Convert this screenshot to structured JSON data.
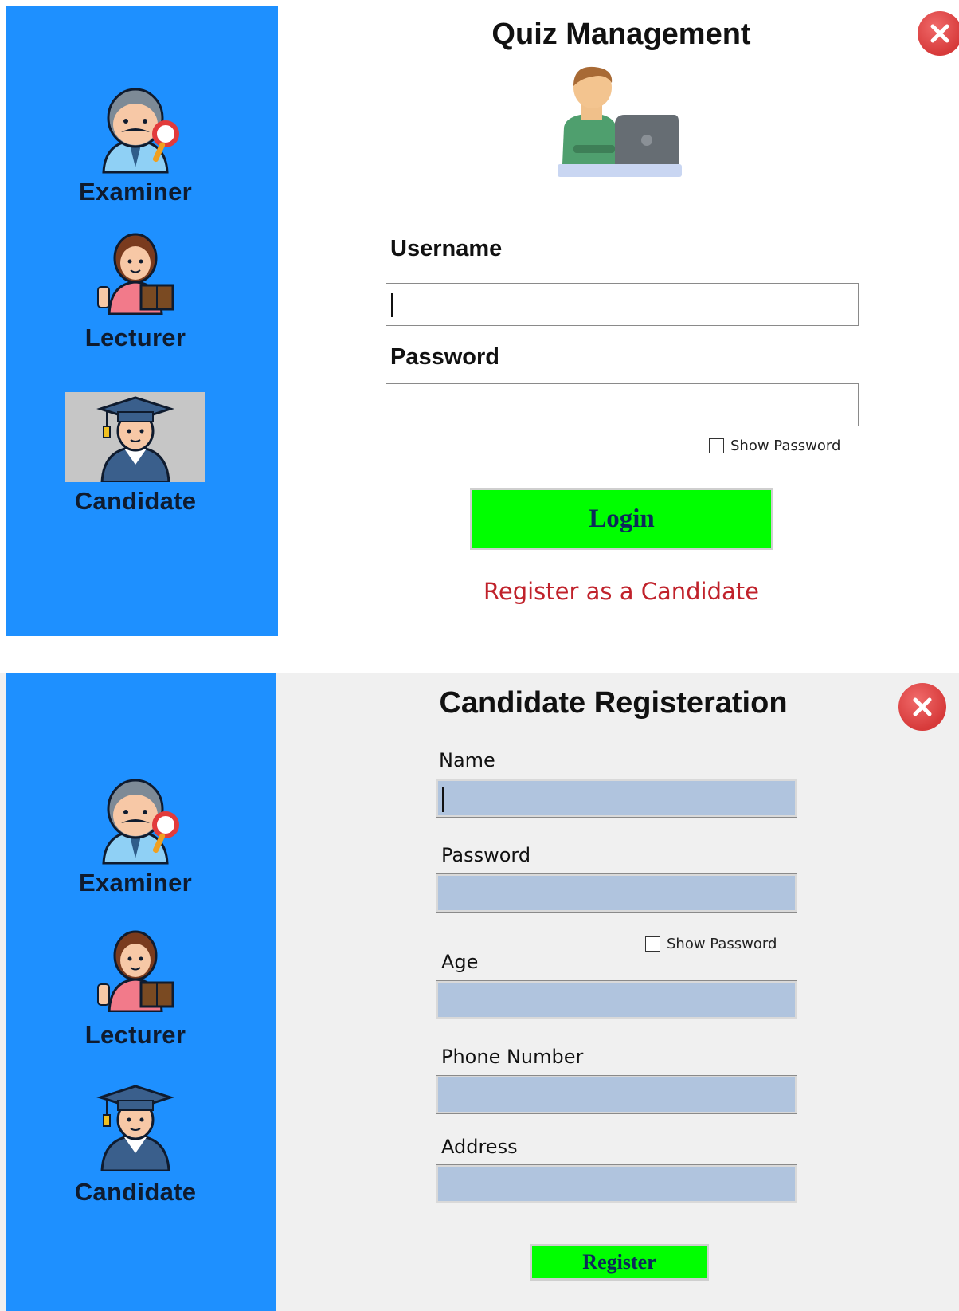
{
  "sidebar": {
    "roles": [
      {
        "label": "Examiner",
        "icon": "examiner-icon"
      },
      {
        "label": "Lecturer",
        "icon": "lecturer-icon"
      },
      {
        "label": "Candidate",
        "icon": "candidate-icon"
      }
    ]
  },
  "login": {
    "title": "Quiz Management",
    "username_label": "Username",
    "password_label": "Password",
    "show_password_label": "Show Password",
    "login_button": "Login",
    "register_link": "Register as a Candidate",
    "selected_role": "Candidate"
  },
  "registration": {
    "title": "Candidate Registeration",
    "name_label": "Name",
    "password_label": "Password",
    "show_password_label": "Show Password",
    "age_label": "Age",
    "phone_label": "Phone Number",
    "address_label": "Address",
    "register_button": "Register"
  },
  "colors": {
    "sidebar": "#1e90ff",
    "login_button": "#00ff00",
    "input_fill": "#b0c4de",
    "link": "#c0222b",
    "close": "#d73a3a"
  }
}
